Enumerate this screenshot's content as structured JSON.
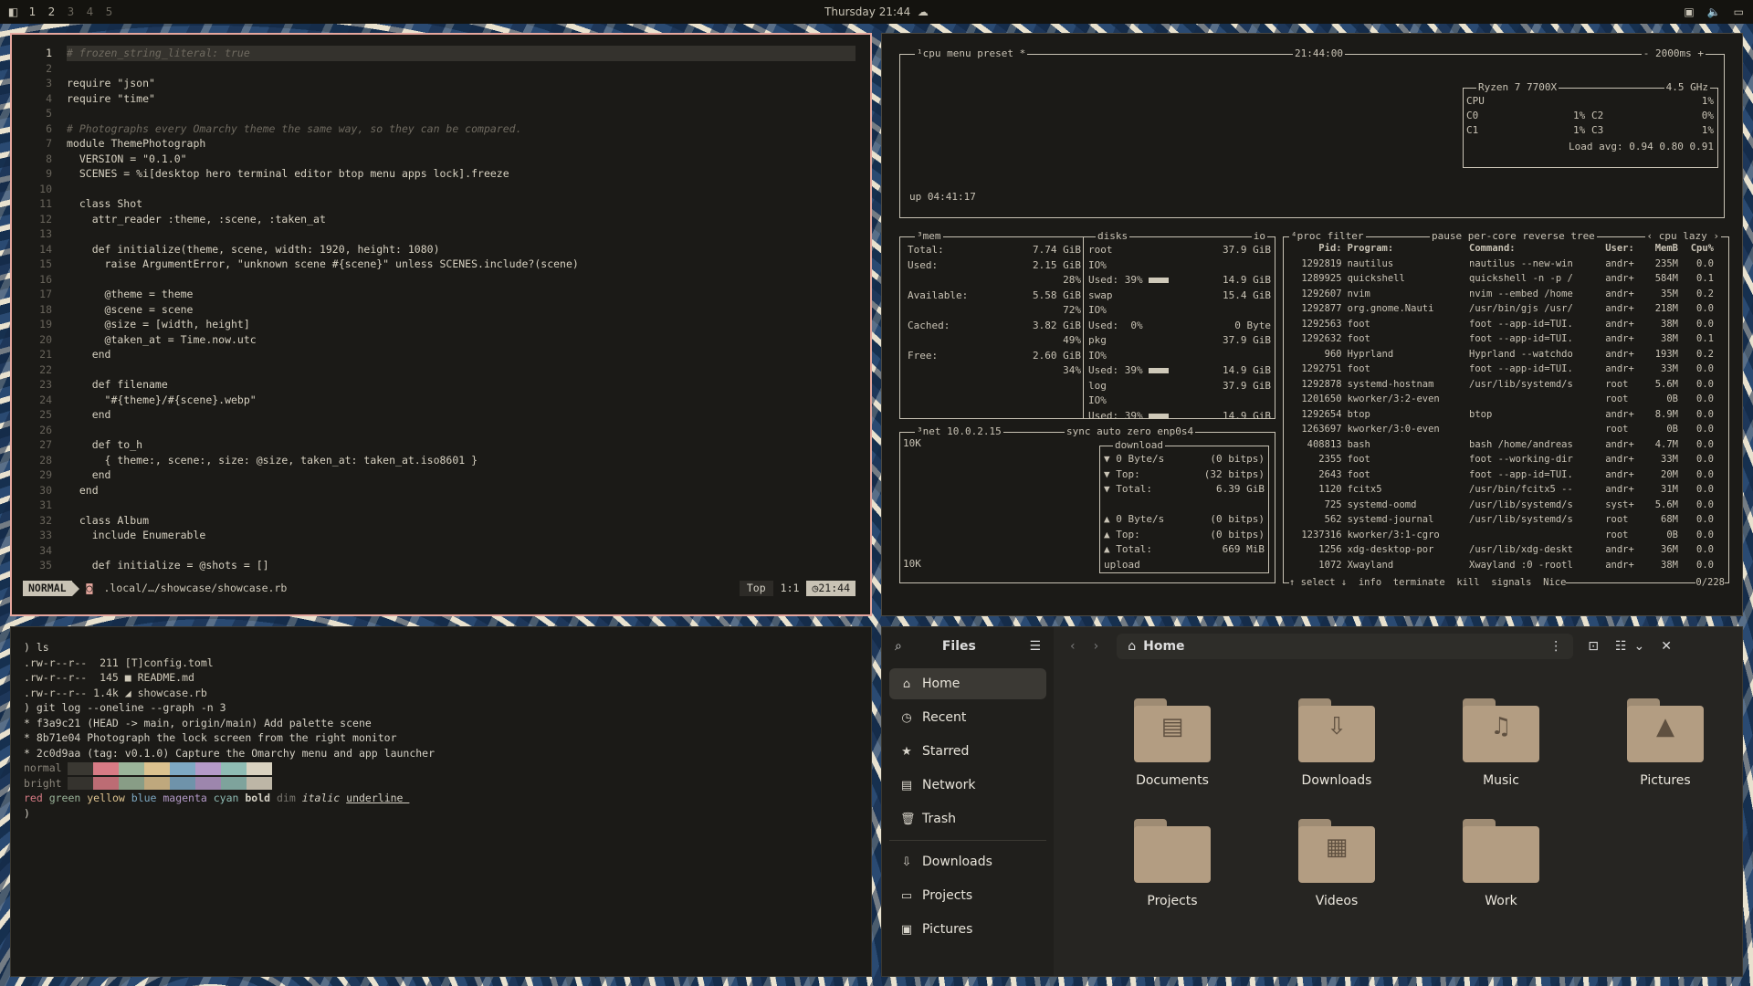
{
  "topbar": {
    "workspaces": [
      "1",
      "2",
      "3",
      "4",
      "5"
    ],
    "clock": "Thursday 21:44",
    "icons": [
      "menu-icon",
      "weather-icon",
      "screen-icon",
      "volume-icon",
      "monitor-icon"
    ]
  },
  "editor": {
    "lines": [
      "# frozen_string_literal: true",
      "",
      "require \"json\"",
      "require \"time\"",
      "",
      "# Photographs every Omarchy theme the same way, so they can be compared.",
      "module ThemePhotograph",
      "  VERSION = \"0.1.0\"",
      "  SCENES = %i[desktop hero terminal editor btop menu apps lock].freeze",
      "",
      "  class Shot",
      "    attr_reader :theme, :scene, :taken_at",
      "",
      "    def initialize(theme, scene, width: 1920, height: 1080)",
      "      raise ArgumentError, \"unknown scene #{scene}\" unless SCENES.include?(scene)",
      "",
      "      @theme = theme",
      "      @scene = scene",
      "      @size = [width, height]",
      "      @taken_at = Time.now.utc",
      "    end",
      "",
      "    def filename",
      "      \"#{theme}/#{scene}.webp\"",
      "    end",
      "",
      "    def to_h",
      "      { theme:, scene:, size: @size, taken_at: taken_at.iso8601 }",
      "    end",
      "  end",
      "",
      "  class Album",
      "    include Enumerable",
      "",
      "    def initialize = @shots = []"
    ],
    "status": {
      "mode": "NORMAL",
      "path": ".local/…/showcase/showcase.rb",
      "pos": "Top",
      "cursor": "1:1",
      "time": "21:44"
    }
  },
  "btop": {
    "cpu": {
      "label": "cpu",
      "menu": "menu",
      "preset": "preset *",
      "time": "21:44:00",
      "refresh": "2000ms",
      "uptime": "up 04:41:17",
      "model": "Ryzen 7 7700X",
      "freq": "4.5 GHz",
      "total": "1%",
      "cores": [
        {
          "n": "C0",
          "v": "1%"
        },
        {
          "n": "C2",
          "v": "0%"
        },
        {
          "n": "C1",
          "v": "1%"
        },
        {
          "n": "C3",
          "v": "1%"
        }
      ],
      "load": "Load avg: 0.94 0.80 0.91"
    },
    "mem": {
      "label": "mem",
      "total": "7.74 GiB",
      "used": "2.15 GiB",
      "used_pct": "28%",
      "avail": "5.58 GiB",
      "avail_pct": "72%",
      "cached": "3.82 GiB",
      "cached_pct": "49%",
      "free": "2.60 GiB",
      "free_pct": "34%"
    },
    "disks": {
      "label": "disks",
      "io": "io",
      "items": [
        {
          "name": "root",
          "size": "37.9 GiB",
          "used": "Used: 39%",
          "u": "14.9 GiB"
        },
        {
          "name": "swap",
          "size": "15.4 GiB",
          "used": "Used:  0%",
          "u": "0 Byte"
        },
        {
          "name": "pkg",
          "size": "37.9 GiB",
          "used": "Used: 39%",
          "u": "14.9 GiB"
        },
        {
          "name": "log",
          "size": "37.9 GiB",
          "used": "Used: 39%",
          "u": "14.9 GiB"
        }
      ]
    },
    "net": {
      "label": "net",
      "ip": "10.0.2.15",
      "sync": "sync",
      "auto": "auto",
      "zero": "zero",
      "iface": "enp0s4",
      "scale": "10K",
      "dl_rate": "0 Byte/s",
      "dl_bits": "(0 bitps)",
      "dl_top": "(32 bitps)",
      "dl_total": "6.39 GiB",
      "ul_rate": "0 Byte/s",
      "ul_bits": "(0 bitps)",
      "ul_top": "(0 bitps)",
      "ul_total": "669 MiB"
    },
    "proc": {
      "label": "proc",
      "filter": "filter",
      "opts": "pause per-core reverse tree",
      "sort": "cpu lazy",
      "count": "0/228",
      "headers": [
        "Pid:",
        "Program:",
        "Command:",
        "User:",
        "MemB",
        "Cpu%"
      ],
      "rows": [
        [
          "1292819",
          "nautilus",
          "nautilus --new-win",
          "andr+",
          "235M",
          "0.0"
        ],
        [
          "1289925",
          "quickshell",
          "quickshell -n -p /",
          "andr+",
          "584M",
          "0.1"
        ],
        [
          "1292607",
          "nvim",
          "nvim --embed /home",
          "andr+",
          "35M",
          "0.2"
        ],
        [
          "1292877",
          "org.gnome.Nauti",
          "/usr/bin/gjs /usr/",
          "andr+",
          "218M",
          "0.0"
        ],
        [
          "1292563",
          "foot",
          "foot --app-id=TUI.",
          "andr+",
          "38M",
          "0.0"
        ],
        [
          "1292632",
          "foot",
          "foot --app-id=TUI.",
          "andr+",
          "38M",
          "0.1"
        ],
        [
          "960",
          "Hyprland",
          "Hyprland --watchdo",
          "andr+",
          "193M",
          "0.2"
        ],
        [
          "1292751",
          "foot",
          "foot --app-id=TUI.",
          "andr+",
          "33M",
          "0.0"
        ],
        [
          "1292878",
          "systemd-hostnam",
          "/usr/lib/systemd/s",
          "root",
          "5.6M",
          "0.0"
        ],
        [
          "1201650",
          "kworker/3:2-even",
          "",
          "root",
          "0B",
          "0.0"
        ],
        [
          "1292654",
          "btop",
          "btop",
          "andr+",
          "8.9M",
          "0.0"
        ],
        [
          "1263697",
          "kworker/3:0-even",
          "",
          "root",
          "0B",
          "0.0"
        ],
        [
          "408813",
          "bash",
          "bash /home/andreas",
          "andr+",
          "4.7M",
          "0.0"
        ],
        [
          "2355",
          "foot",
          "foot --working-dir",
          "andr+",
          "33M",
          "0.0"
        ],
        [
          "2643",
          "foot",
          "foot --app-id=TUI.",
          "andr+",
          "20M",
          "0.0"
        ],
        [
          "1120",
          "fcitx5",
          "/usr/bin/fcitx5 --",
          "andr+",
          "31M",
          "0.0"
        ],
        [
          "725",
          "systemd-oomd",
          "/usr/lib/systemd/s",
          "syst+",
          "5.6M",
          "0.0"
        ],
        [
          "562",
          "systemd-journal",
          "/usr/lib/systemd/s",
          "root",
          "68M",
          "0.0"
        ],
        [
          "1237316",
          "kworker/3:1-cgro",
          "",
          "root",
          "0B",
          "0.0"
        ],
        [
          "1256",
          "xdg-desktop-por",
          "/usr/lib/xdg-deskt",
          "andr+",
          "36M",
          "0.0"
        ],
        [
          "1072",
          "Xwayland",
          "Xwayland :0 -rootl",
          "andr+",
          "38M",
          "0.0"
        ]
      ],
      "footer": "↑ select ↓  info  terminate  kill  signals  Nice"
    }
  },
  "terminal": {
    "lines": [
      ") ls",
      ".rw-r--r--  211 [T]config.toml",
      ".rw-r--r--  145 ■ README.md",
      ".rw-r--r-- 1.4k ◢ showcase.rb",
      ") git log --oneline --graph -n 3",
      "* f3a9c21 (HEAD -> main, origin/main) Add palette scene",
      "* 8b71e04 Photograph the lock screen from the right monitor",
      "* 2c0d9aa (tag: v0.1.0) Capture the Omarchy menu and app launcher"
    ],
    "normal": "normal",
    "bright": "bright",
    "styles": "red green yellow blue magenta cyan bold dim italic underline",
    "prompt": ")",
    "palette": [
      "#3a3832",
      "#d87b85",
      "#9bb59a",
      "#dcc28f",
      "#7ea9c4",
      "#b49ac8",
      "#8fbcb4",
      "#d9d2c0"
    ]
  },
  "files": {
    "title": "Files",
    "location": "Home",
    "sidebar": [
      {
        "label": "Home",
        "icon": "⌂"
      },
      {
        "label": "Recent",
        "icon": "◷"
      },
      {
        "label": "Starred",
        "icon": "★"
      },
      {
        "label": "Network",
        "icon": "▤"
      },
      {
        "label": "Trash",
        "icon": "🗑"
      }
    ],
    "bookmarks": [
      {
        "label": "Downloads",
        "icon": "⇩"
      },
      {
        "label": "Projects",
        "icon": "▭"
      },
      {
        "label": "Pictures",
        "icon": "▣"
      }
    ],
    "folders": [
      {
        "name": "Documents",
        "glyph": "▤"
      },
      {
        "name": "Downloads",
        "glyph": "⇩"
      },
      {
        "name": "Music",
        "glyph": "♫"
      },
      {
        "name": "Pictures",
        "glyph": "▲"
      },
      {
        "name": "Projects",
        "glyph": ""
      },
      {
        "name": "Videos",
        "glyph": "▦"
      },
      {
        "name": "Work",
        "glyph": ""
      }
    ]
  }
}
